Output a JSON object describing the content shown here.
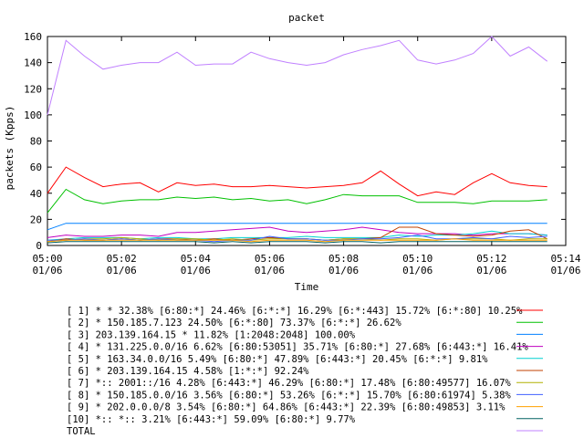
{
  "chart_data": {
    "type": "line",
    "title": "packet",
    "xlabel": "Time",
    "ylabel": "packets (Kpps)",
    "ylim": [
      0,
      160
    ],
    "yticks": [
      0,
      20,
      40,
      60,
      80,
      100,
      120,
      140,
      160
    ],
    "xlim": [
      0,
      14
    ],
    "xticks": [
      {
        "v": 0,
        "t": "05:00",
        "d": "01/06"
      },
      {
        "v": 2,
        "t": "05:02",
        "d": "01/06"
      },
      {
        "v": 4,
        "t": "05:04",
        "d": "01/06"
      },
      {
        "v": 6,
        "t": "05:06",
        "d": "01/06"
      },
      {
        "v": 8,
        "t": "05:08",
        "d": "01/06"
      },
      {
        "v": 10,
        "t": "05:10",
        "d": "01/06"
      },
      {
        "v": 12,
        "t": "05:12",
        "d": "01/06"
      },
      {
        "v": 14,
        "t": "05:14",
        "d": "01/06"
      }
    ],
    "x": [
      0,
      0.5,
      1,
      1.5,
      2,
      2.5,
      3,
      3.5,
      4,
      4.5,
      5,
      5.5,
      6,
      6.5,
      7,
      7.5,
      8,
      8.5,
      9,
      9.5,
      10,
      10.5,
      11,
      11.5,
      12,
      12.5,
      13,
      13.5
    ],
    "series": [
      {
        "name": "[ 1] * * 32.38%  [6:80:*] 24.46% [6:*:*] 16.29% [6:*:443] 15.72% [6:*:80] 10.25%",
        "color": "#ff0000",
        "values": [
          40,
          60,
          52,
          45,
          47,
          48,
          41,
          48,
          46,
          47,
          45,
          45,
          46,
          45,
          44,
          45,
          46,
          48,
          57,
          47,
          38,
          41,
          39,
          48,
          55,
          48,
          46,
          45
        ]
      },
      {
        "name": "[ 2] * 150.185.7.123 24.50%  [6:*:80] 73.37% [6:*:*] 26.62%",
        "color": "#00c000",
        "values": [
          25,
          43,
          35,
          32,
          34,
          35,
          35,
          37,
          36,
          37,
          35,
          36,
          34,
          35,
          32,
          35,
          39,
          38,
          38,
          38,
          33,
          33,
          33,
          32,
          34,
          34,
          34,
          35
        ]
      },
      {
        "name": "[ 3] 203.139.164.15 * 11.82%  [1:2048:2048] 100.00%",
        "color": "#0080ff",
        "values": [
          12,
          17,
          17,
          17,
          17,
          17,
          17,
          17,
          17,
          17,
          17,
          17,
          17,
          17,
          17,
          17,
          17,
          17,
          17,
          17,
          17,
          17,
          17,
          17,
          17,
          17,
          17,
          17
        ]
      },
      {
        "name": "[ 4] * 131.225.0.0/16 6.62%  [6:80:53051] 35.71% [6:80:*] 27.68% [6:443:*] 16.41%",
        "color": "#c000c0",
        "values": [
          6,
          8,
          7,
          7,
          8,
          8,
          7,
          10,
          10,
          11,
          12,
          13,
          14,
          11,
          10,
          11,
          12,
          14,
          12,
          10,
          9,
          9,
          9,
          8,
          9,
          9,
          9,
          8
        ]
      },
      {
        "name": "[ 5] * 163.34.0.0/16 5.49%  [6:80:*] 47.89% [6:443:*] 20.45% [6:*:*] 9.81%",
        "color": "#00d0d0",
        "values": [
          4,
          5,
          6,
          6,
          6,
          5,
          6,
          6,
          5,
          5,
          6,
          6,
          6,
          6,
          7,
          6,
          6,
          6,
          6,
          8,
          7,
          8,
          8,
          9,
          11,
          9,
          9,
          8
        ]
      },
      {
        "name": "[ 6] * 203.139.164.15 4.58%  [1:*:*] 92.24%",
        "color": "#c04000",
        "values": [
          3,
          5,
          4,
          4,
          5,
          4,
          5,
          5,
          4,
          5,
          4,
          5,
          6,
          5,
          5,
          4,
          5,
          5,
          6,
          14,
          14,
          9,
          8,
          7,
          8,
          11,
          12,
          5
        ]
      },
      {
        "name": "[ 7] *:: 2001::/16 4.28%  [6:443:*] 46.29% [6:80:*] 17.48% [6:80:49577] 16.07%",
        "color": "#b0b000",
        "values": [
          3,
          4,
          5,
          5,
          6,
          5,
          4,
          5,
          5,
          4,
          5,
          4,
          5,
          5,
          5,
          4,
          5,
          5,
          4,
          5,
          5,
          4,
          5,
          5,
          5,
          4,
          5,
          5
        ]
      },
      {
        "name": "[ 8] * 150.185.0.0/16 3.56%  [6:80:*] 53.26% [6:*:*] 15.70% [6:80:61974] 5.38%",
        "color": "#4060ff",
        "values": [
          4,
          4,
          5,
          4,
          5,
          4,
          5,
          4,
          4,
          3,
          4,
          4,
          7,
          5,
          5,
          4,
          4,
          5,
          5,
          6,
          8,
          5,
          5,
          6,
          5,
          7,
          6,
          7
        ]
      },
      {
        "name": "[ 9] * 202.0.0.0/8 3.54%  [6:80:*] 64.86% [6:443:*] 22.39% [6:80:49853] 3.11%",
        "color": "#ffa000",
        "values": [
          3,
          4,
          4,
          4,
          4,
          4,
          4,
          4,
          4,
          4,
          4,
          3,
          4,
          4,
          4,
          3,
          4,
          4,
          4,
          4,
          4,
          4,
          5,
          4,
          4,
          4,
          4,
          4
        ]
      },
      {
        "name": "[10] *:: *:: 3.21%  [6:443:*] 59.09% [6:80:*] 9.77%",
        "color": "#006060",
        "values": [
          2,
          3,
          3,
          3,
          3,
          3,
          3,
          3,
          3,
          2,
          3,
          2,
          3,
          3,
          3,
          2,
          3,
          3,
          2,
          3,
          3,
          3,
          3,
          3,
          3,
          3,
          3,
          3
        ]
      },
      {
        "name": "TOTAL",
        "color": "#c080ff",
        "values": [
          100,
          157,
          145,
          135,
          138,
          140,
          140,
          148,
          138,
          139,
          139,
          148,
          143,
          140,
          138,
          140,
          146,
          150,
          153,
          157,
          142,
          139,
          142,
          147,
          160,
          145,
          152,
          141
        ]
      }
    ],
    "legend_position": "bottom",
    "grid": false
  }
}
